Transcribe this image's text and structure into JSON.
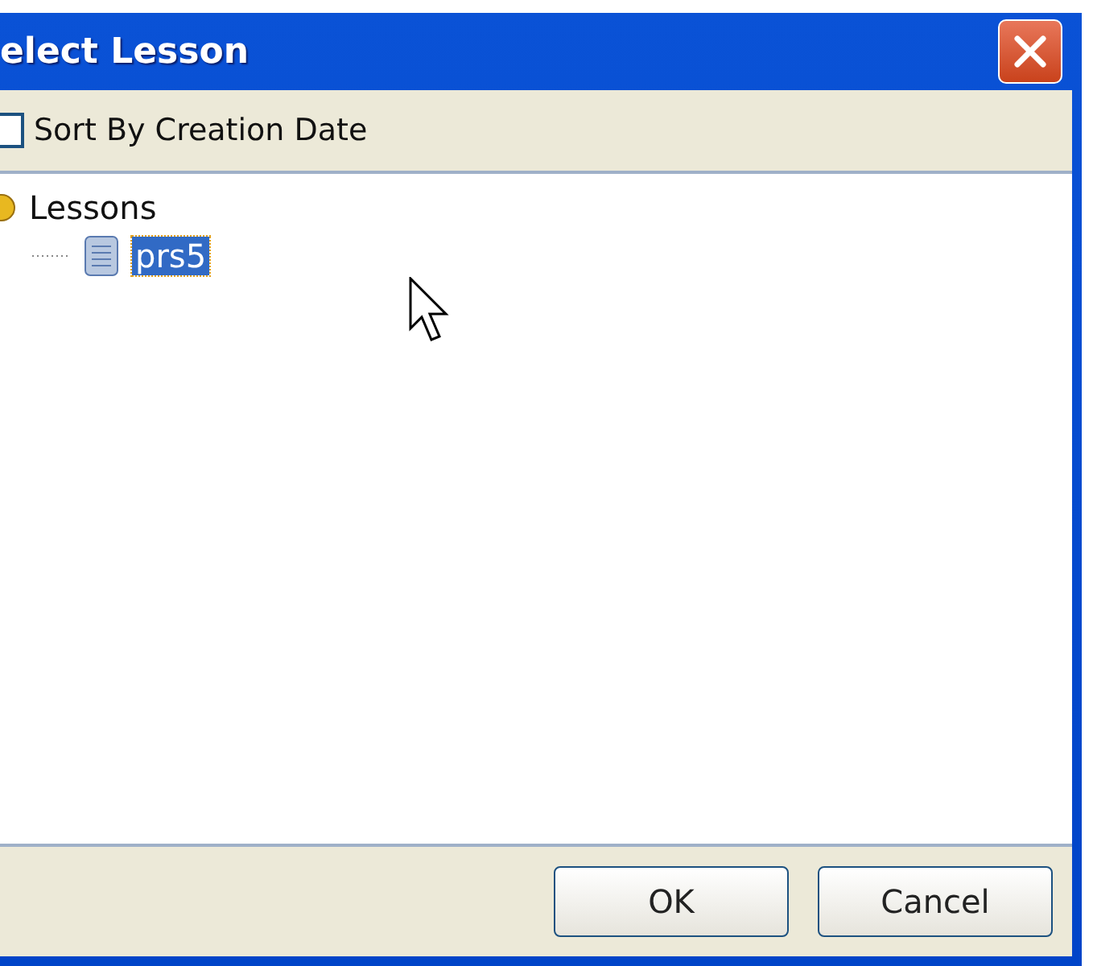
{
  "window": {
    "title": "elect Lesson"
  },
  "toolbar": {
    "checkbox": {
      "label": "Sort By Creation Date",
      "checked": false
    }
  },
  "tree": [
    {
      "label": "Lessons",
      "kind": "folder",
      "selected": false,
      "children": [
        {
          "label": "prs5",
          "kind": "lesson",
          "selected": true
        }
      ]
    }
  ],
  "buttons": [
    "OK",
    "Cancel"
  ]
}
